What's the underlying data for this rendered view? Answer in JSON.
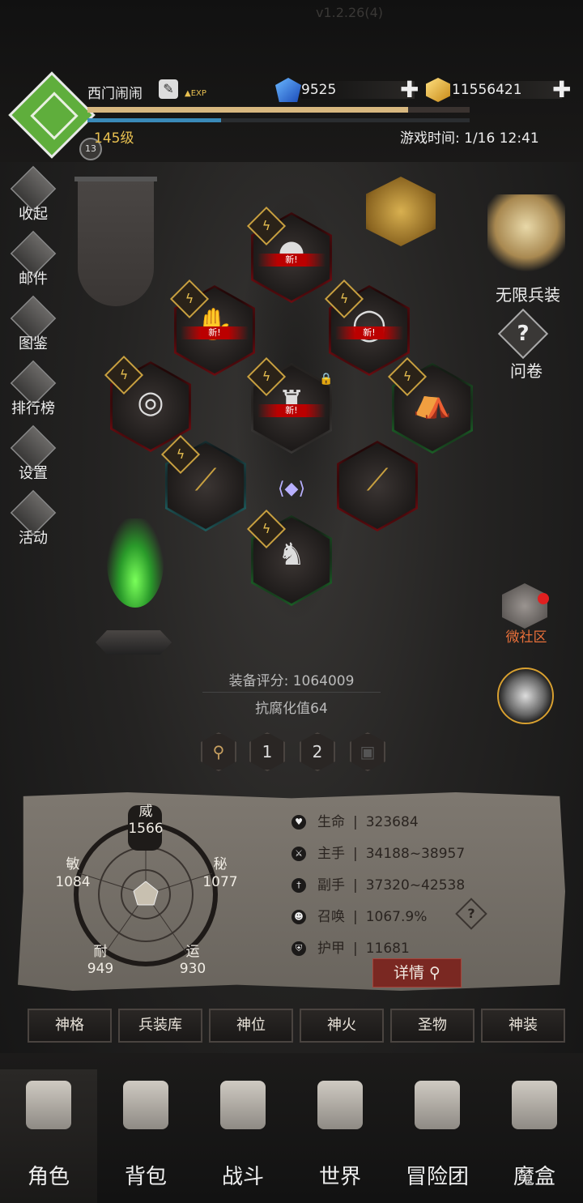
{
  "header": {
    "player_name": "西门闹闹",
    "level": "145级",
    "avatar_badge": "13",
    "gems": "9525",
    "gold": "11556421",
    "game_time": "游戏时间: 1/16 12:41",
    "version": "v1.2.26(4)"
  },
  "left_menu": [
    {
      "label": "收起",
      "icon": "collapse-icon"
    },
    {
      "label": "邮件",
      "icon": "mail-icon"
    },
    {
      "label": "图鉴",
      "icon": "book-icon"
    },
    {
      "label": "排行榜",
      "icon": "ranking-icon"
    },
    {
      "label": "设置",
      "icon": "gear-icon"
    },
    {
      "label": "活动",
      "icon": "event-icon"
    }
  ],
  "right_menu": {
    "infinite": "无限兵装",
    "survey": "问卷",
    "community": "微社区"
  },
  "equipment": {
    "new_tag": "新!",
    "score": "装备评分: 1064009",
    "anti_corruption": "抗腐化值64"
  },
  "slots": [
    "1",
    "2"
  ],
  "radar": {
    "wei_label": "威",
    "wei_value": "1566",
    "mi_label": "秘",
    "mi_value": "1077",
    "yun_label": "运",
    "yun_value": "930",
    "nai_label": "耐",
    "nai_value": "949",
    "min_label": "敏",
    "min_value": "1084"
  },
  "stats": [
    {
      "name": "生命",
      "value": "323684"
    },
    {
      "name": "主手",
      "value": "34188~38957"
    },
    {
      "name": "副手",
      "value": "37320~42538"
    },
    {
      "name": "召唤",
      "value": "1067.9%"
    },
    {
      "name": "护甲",
      "value": "11681"
    }
  ],
  "detail_button": "详情",
  "tabs": [
    "神格",
    "兵装库",
    "神位",
    "神火",
    "圣物",
    "神装"
  ],
  "bottom_nav": [
    "角色",
    "背包",
    "战斗",
    "世界",
    "冒险团",
    "魔盒"
  ],
  "colors": {
    "red_rarity": "#c0101a",
    "green_rarity": "#1fa838",
    "teal_rarity": "#2aa8a8",
    "gold": "#e8c050"
  }
}
